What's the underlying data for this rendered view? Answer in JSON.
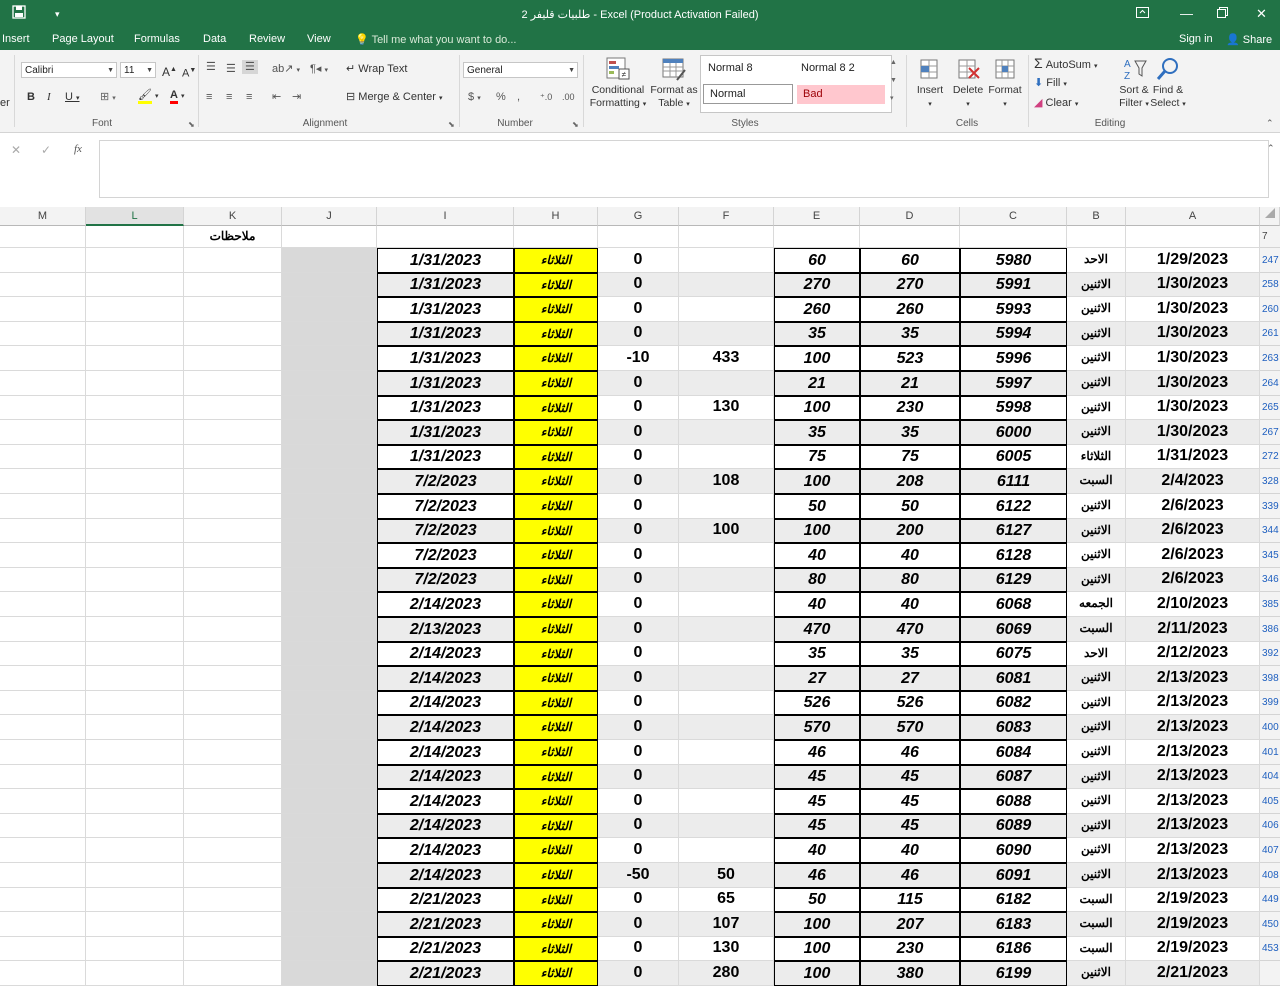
{
  "window": {
    "title": "طلبيات قليفر 2 - Excel (Product Activation Failed)"
  },
  "tabs": [
    "Insert",
    "Page Layout",
    "Formulas",
    "Data",
    "Review",
    "View"
  ],
  "tell_me": "Tell me what you want to do...",
  "account": {
    "sign_in": "Sign in",
    "share": "Share"
  },
  "ribbon": {
    "font": {
      "name": "Calibri",
      "size": "11",
      "label": "Font"
    },
    "alignment": {
      "wrap": "Wrap Text",
      "merge": "Merge & Center",
      "label": "Alignment"
    },
    "number": {
      "format": "General",
      "label": "Number"
    },
    "styles": {
      "conditional": [
        "Conditional",
        "Formatting"
      ],
      "format_as_table": [
        "Format as",
        "Table"
      ],
      "cells": [
        "Normal 8",
        "Normal 8 2",
        "Normal",
        "Bad"
      ],
      "label": "Styles"
    },
    "cells": {
      "insert": "Insert",
      "delete": "Delete",
      "format": "Format",
      "label": "Cells"
    },
    "editing": {
      "autosum": "AutoSum",
      "fill": "Fill",
      "clear": "Clear",
      "sort": [
        "Sort &",
        "Filter"
      ],
      "find": [
        "Find &",
        "Select"
      ],
      "label": "Editing"
    },
    "cut_label": "er"
  },
  "formula_bar": {
    "fx": "fx"
  },
  "columns": [
    "M",
    "L",
    "K",
    "J",
    "I",
    "H",
    "G",
    "F",
    "E",
    "D",
    "C",
    "B",
    "A"
  ],
  "header_row": {
    "row_num": "7",
    "notes": "ملاحظات"
  },
  "colors": {
    "excel_green": "#217346",
    "highlight_yellow": "#ffff00",
    "bad_fill": "#ffc7ce",
    "bad_text": "#9c0006"
  },
  "rows": [
    {
      "n": "247",
      "a": "1/29/2023",
      "b": "الاحد",
      "c": "5980",
      "d": "60",
      "e": "60",
      "f": "",
      "g": "0",
      "h": "الثلاثاء",
      "i": "1/31/2023"
    },
    {
      "n": "258",
      "a": "1/30/2023",
      "b": "الاثنين",
      "c": "5991",
      "d": "270",
      "e": "270",
      "f": "",
      "g": "0",
      "h": "الثلاثاء",
      "i": "1/31/2023"
    },
    {
      "n": "260",
      "a": "1/30/2023",
      "b": "الاثنين",
      "c": "5993",
      "d": "260",
      "e": "260",
      "f": "",
      "g": "0",
      "h": "الثلاثاء",
      "i": "1/31/2023"
    },
    {
      "n": "261",
      "a": "1/30/2023",
      "b": "الاثنين",
      "c": "5994",
      "d": "35",
      "e": "35",
      "f": "",
      "g": "0",
      "h": "الثلاثاء",
      "i": "1/31/2023"
    },
    {
      "n": "263",
      "a": "1/30/2023",
      "b": "الاثنين",
      "c": "5996",
      "d": "523",
      "e": "100",
      "f": "433",
      "g": "-10",
      "h": "الثلاثاء",
      "i": "1/31/2023"
    },
    {
      "n": "264",
      "a": "1/30/2023",
      "b": "الاثنين",
      "c": "5997",
      "d": "21",
      "e": "21",
      "f": "",
      "g": "0",
      "h": "الثلاثاء",
      "i": "1/31/2023"
    },
    {
      "n": "265",
      "a": "1/30/2023",
      "b": "الاثنين",
      "c": "5998",
      "d": "230",
      "e": "100",
      "f": "130",
      "g": "0",
      "h": "الثلاثاء",
      "i": "1/31/2023"
    },
    {
      "n": "267",
      "a": "1/30/2023",
      "b": "الاثنين",
      "c": "6000",
      "d": "35",
      "e": "35",
      "f": "",
      "g": "0",
      "h": "الثلاثاء",
      "i": "1/31/2023"
    },
    {
      "n": "272",
      "a": "1/31/2023",
      "b": "الثلاثاء",
      "c": "6005",
      "d": "75",
      "e": "75",
      "f": "",
      "g": "0",
      "h": "الثلاثاء",
      "i": "1/31/2023"
    },
    {
      "n": "328",
      "a": "2/4/2023",
      "b": "السبت",
      "c": "6111",
      "d": "208",
      "e": "100",
      "f": "108",
      "g": "0",
      "h": "الثلاثاء",
      "i": "7/2/2023"
    },
    {
      "n": "339",
      "a": "2/6/2023",
      "b": "الاثنين",
      "c": "6122",
      "d": "50",
      "e": "50",
      "f": "",
      "g": "0",
      "h": "الثلاثاء",
      "i": "7/2/2023"
    },
    {
      "n": "344",
      "a": "2/6/2023",
      "b": "الاثنين",
      "c": "6127",
      "d": "200",
      "e": "100",
      "f": "100",
      "g": "0",
      "h": "الثلاثاء",
      "i": "7/2/2023"
    },
    {
      "n": "345",
      "a": "2/6/2023",
      "b": "الاثنين",
      "c": "6128",
      "d": "40",
      "e": "40",
      "f": "",
      "g": "0",
      "h": "الثلاثاء",
      "i": "7/2/2023"
    },
    {
      "n": "346",
      "a": "2/6/2023",
      "b": "الاثنين",
      "c": "6129",
      "d": "80",
      "e": "80",
      "f": "",
      "g": "0",
      "h": "الثلاثاء",
      "i": "7/2/2023"
    },
    {
      "n": "385",
      "a": "2/10/2023",
      "b": "الجمعه",
      "c": "6068",
      "d": "40",
      "e": "40",
      "f": "",
      "g": "0",
      "h": "الثلاثاء",
      "i": "2/14/2023"
    },
    {
      "n": "386",
      "a": "2/11/2023",
      "b": "السبت",
      "c": "6069",
      "d": "470",
      "e": "470",
      "f": "",
      "g": "0",
      "h": "الثلاثاء",
      "i": "2/13/2023"
    },
    {
      "n": "392",
      "a": "2/12/2023",
      "b": "الاحد",
      "c": "6075",
      "d": "35",
      "e": "35",
      "f": "",
      "g": "0",
      "h": "الثلاثاء",
      "i": "2/14/2023"
    },
    {
      "n": "398",
      "a": "2/13/2023",
      "b": "الاثنين",
      "c": "6081",
      "d": "27",
      "e": "27",
      "f": "",
      "g": "0",
      "h": "الثلاثاء",
      "i": "2/14/2023"
    },
    {
      "n": "399",
      "a": "2/13/2023",
      "b": "الاثنين",
      "c": "6082",
      "d": "526",
      "e": "526",
      "f": "",
      "g": "0",
      "h": "الثلاثاء",
      "i": "2/14/2023"
    },
    {
      "n": "400",
      "a": "2/13/2023",
      "b": "الاثنين",
      "c": "6083",
      "d": "570",
      "e": "570",
      "f": "",
      "g": "0",
      "h": "الثلاثاء",
      "i": "2/14/2023"
    },
    {
      "n": "401",
      "a": "2/13/2023",
      "b": "الاثنين",
      "c": "6084",
      "d": "46",
      "e": "46",
      "f": "",
      "g": "0",
      "h": "الثلاثاء",
      "i": "2/14/2023"
    },
    {
      "n": "404",
      "a": "2/13/2023",
      "b": "الاثنين",
      "c": "6087",
      "d": "45",
      "e": "45",
      "f": "",
      "g": "0",
      "h": "الثلاثاء",
      "i": "2/14/2023"
    },
    {
      "n": "405",
      "a": "2/13/2023",
      "b": "الاثنين",
      "c": "6088",
      "d": "45",
      "e": "45",
      "f": "",
      "g": "0",
      "h": "الثلاثاء",
      "i": "2/14/2023"
    },
    {
      "n": "406",
      "a": "2/13/2023",
      "b": "الاثنين",
      "c": "6089",
      "d": "45",
      "e": "45",
      "f": "",
      "g": "0",
      "h": "الثلاثاء",
      "i": "2/14/2023"
    },
    {
      "n": "407",
      "a": "2/13/2023",
      "b": "الاثنين",
      "c": "6090",
      "d": "40",
      "e": "40",
      "f": "",
      "g": "0",
      "h": "الثلاثاء",
      "i": "2/14/2023"
    },
    {
      "n": "408",
      "a": "2/13/2023",
      "b": "الاثنين",
      "c": "6091",
      "d": "46",
      "e": "46",
      "f": "50",
      "g": "-50",
      "h": "الثلاثاء",
      "i": "2/14/2023"
    },
    {
      "n": "449",
      "a": "2/19/2023",
      "b": "السبت",
      "c": "6182",
      "d": "115",
      "e": "50",
      "f": "65",
      "g": "0",
      "h": "الثلاثاء",
      "i": "2/21/2023"
    },
    {
      "n": "450",
      "a": "2/19/2023",
      "b": "السبت",
      "c": "6183",
      "d": "207",
      "e": "100",
      "f": "107",
      "g": "0",
      "h": "الثلاثاء",
      "i": "2/21/2023"
    },
    {
      "n": "453",
      "a": "2/19/2023",
      "b": "السبت",
      "c": "6186",
      "d": "230",
      "e": "100",
      "f": "130",
      "g": "0",
      "h": "الثلاثاء",
      "i": "2/21/2023"
    },
    {
      "n": "",
      "a": "2/21/2023",
      "b": "الاثنين",
      "c": "6199",
      "d": "380",
      "e": "100",
      "f": "280",
      "g": "0",
      "h": "الثلاثاء",
      "i": "2/21/2023"
    }
  ]
}
